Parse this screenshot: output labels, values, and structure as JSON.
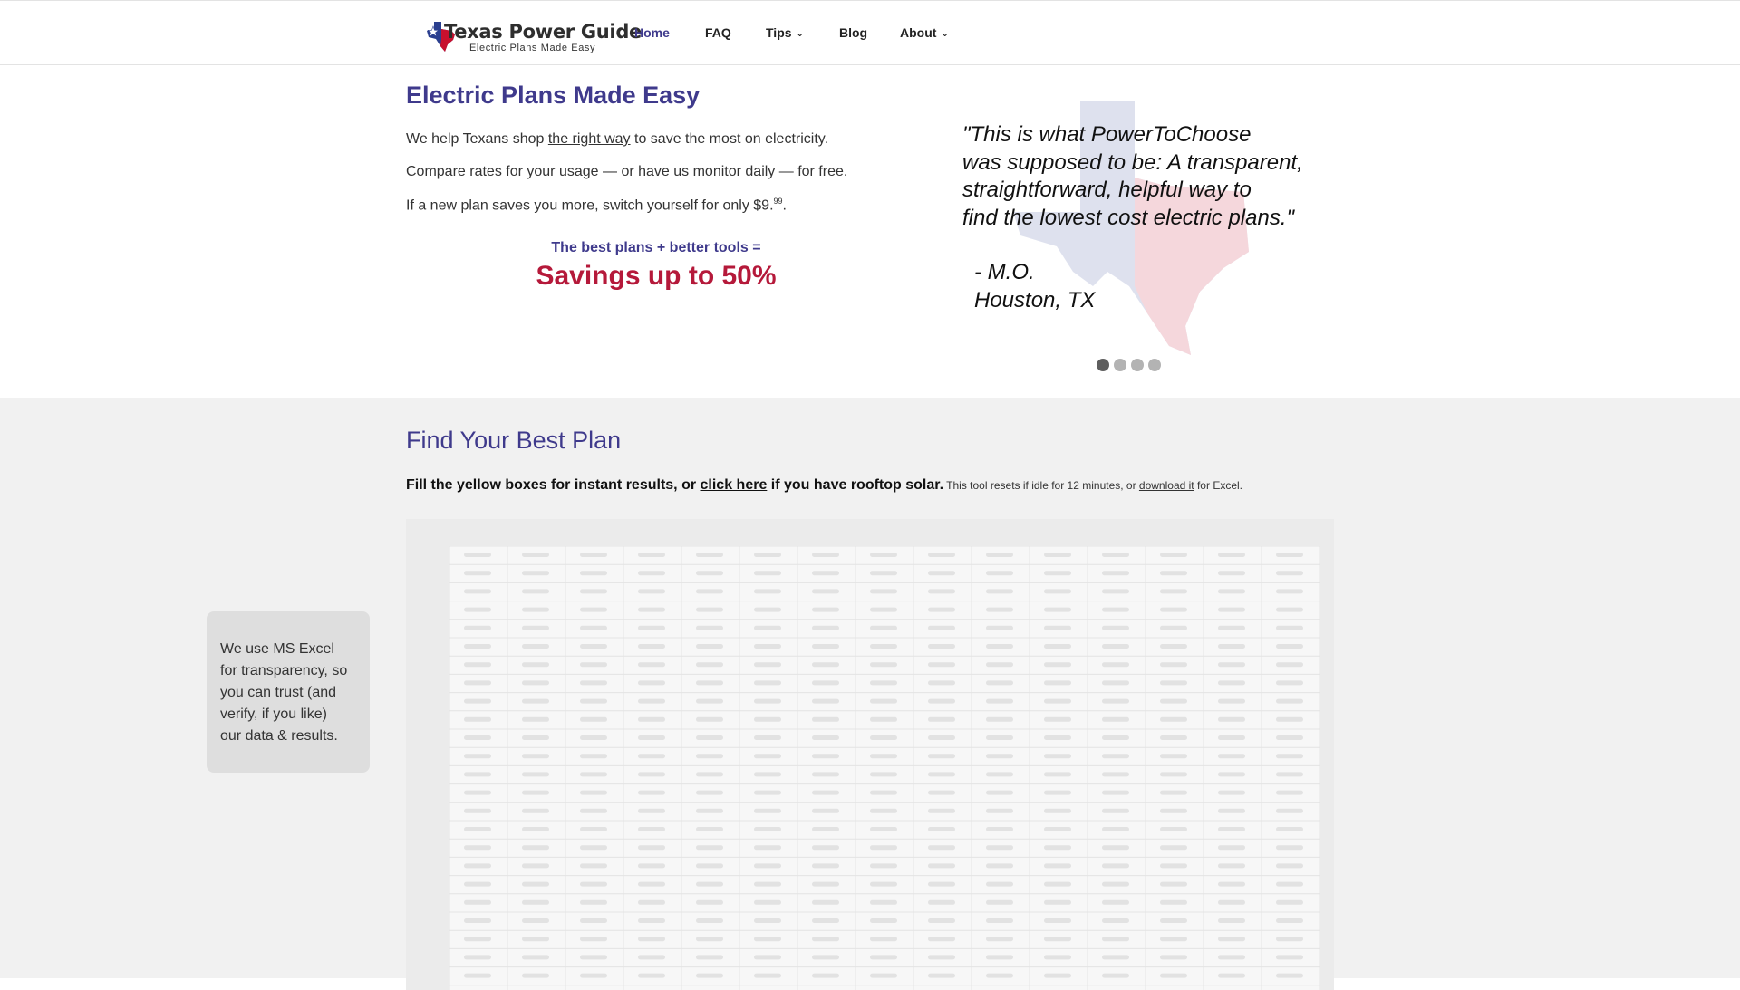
{
  "header": {
    "logo": {
      "title": "Texas Power Guide",
      "tagline": "Electric Plans Made Easy",
      "icon": "texas-flag-star-icon"
    },
    "nav": [
      {
        "label": "Home",
        "active": true,
        "has_dropdown": false
      },
      {
        "label": "FAQ",
        "active": false,
        "has_dropdown": false
      },
      {
        "label": "Tips",
        "active": false,
        "has_dropdown": true
      },
      {
        "label": "Blog",
        "active": false,
        "has_dropdown": false
      },
      {
        "label": "About",
        "active": false,
        "has_dropdown": true
      }
    ]
  },
  "hero": {
    "title": "Electric Plans Made Easy",
    "line1": {
      "before": "We help Texans shop ",
      "link": "the right way",
      "after": " to save the most on electricity."
    },
    "line2": "Compare rates for your usage — or have us monitor daily — for free.",
    "line3": {
      "text": "If a new plan saves you more, switch yourself for only $9.",
      "cents": "99",
      "end": "."
    },
    "tools_line": "The best plans + better tools =",
    "savings_line": "Savings up to 50%",
    "testimonial": {
      "lines": [
        "\"This is what PowerToChoose",
        "was supposed to be: A transparent,",
        "straightforward, helpful way to",
        "find the lowest cost electric plans.\""
      ],
      "author": "- M.O.",
      "location": "Houston, TX"
    },
    "carousel": {
      "count": 4,
      "active_index": 0
    }
  },
  "plan_section": {
    "title": "Find Your Best Plan",
    "intro": {
      "strong_before": "Fill the yellow boxes for instant results, or ",
      "strong_link": "click here",
      "strong_after": " if you have rooftop solar.",
      "small_before": " This tool resets if idle for 12 minutes, or ",
      "small_link": "download it",
      "small_after": " for Excel."
    },
    "side_note": [
      "We use MS Excel",
      "for transparency, so",
      "you can trust (and",
      "verify, if you like)",
      "our data & results."
    ]
  },
  "colors": {
    "brand_purple": "#3f3a8c",
    "savings_red": "#b5193a",
    "section_gray": "#f1f1f1",
    "note_gray": "#dedede"
  }
}
